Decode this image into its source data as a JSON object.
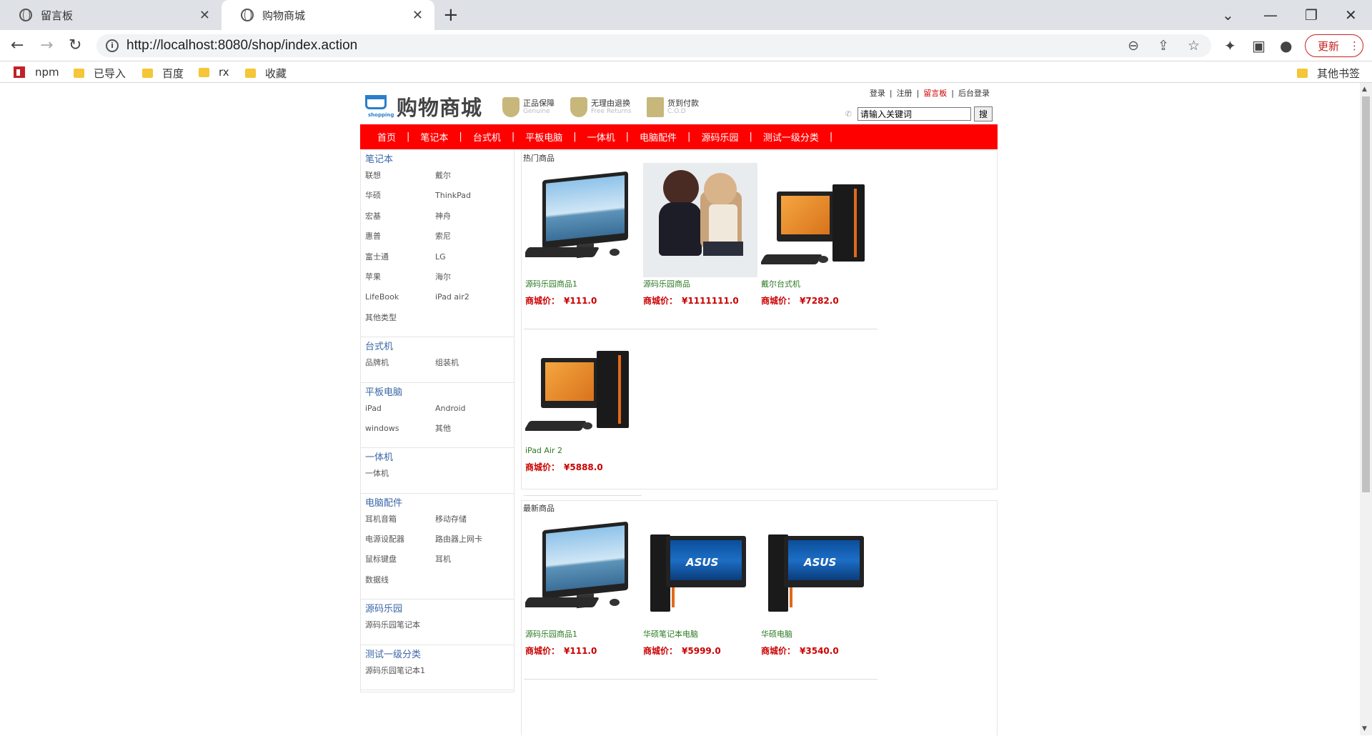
{
  "browser": {
    "tabs": [
      {
        "title": "留言板"
      },
      {
        "title": "购物商城"
      }
    ],
    "url": "http://localhost:8080/shop/index.action",
    "update_label": "更新",
    "bookmarks": [
      "npm",
      "已导入",
      "百度",
      "rx",
      "收藏"
    ],
    "other_bookmarks": "其他书签"
  },
  "site": {
    "logo_text": "购物商城",
    "logo_sub": "shopping",
    "badges": [
      {
        "title": "正品保障",
        "sub": "Genuine"
      },
      {
        "title": "无理由退换",
        "sub": "Free Returns"
      },
      {
        "title": "货到付款",
        "sub": "C.O.D"
      }
    ],
    "toplinks": {
      "login": "登录",
      "register": "注册",
      "guestbook": "留言板",
      "admin": "后台登录",
      "sep": "|"
    },
    "search": {
      "value": "请输入关键词",
      "button": "搜"
    },
    "nav": [
      "首页",
      "笔记本",
      "台式机",
      "平板电脑",
      "一体机",
      "电脑配件",
      "源码乐园",
      "测试一级分类"
    ],
    "nav_sep": "|",
    "categories": [
      {
        "name": "笔记本",
        "subs": [
          "联想",
          "戴尔",
          "华硕",
          "ThinkPad",
          "宏基",
          "神舟",
          "惠普",
          "索尼",
          "富士通",
          "LG",
          "苹果",
          "海尔",
          "LifeBook",
          "iPad air2",
          "其他类型"
        ]
      },
      {
        "name": "台式机",
        "subs": [
          "品牌机",
          "组装机"
        ]
      },
      {
        "name": "平板电脑",
        "subs": [
          "iPad",
          "Android",
          "windows",
          "其他"
        ]
      },
      {
        "name": "一体机",
        "subs": [
          "一体机"
        ]
      },
      {
        "name": "电脑配件",
        "subs": [
          "耳机音箱",
          "移动存储",
          "电源设配器",
          "路由器上网卡",
          "鼠标键盘",
          "耳机",
          "数据线"
        ]
      },
      {
        "name": "源码乐园",
        "subs": [
          "源码乐园笔记本"
        ]
      },
      {
        "name": "测试一级分类",
        "subs": [
          "源码乐园笔记本1"
        ]
      }
    ],
    "price_label": "商城价：",
    "hot": {
      "title": "热门商品",
      "products": [
        {
          "name": "源码乐园商品1",
          "price": "¥111.0",
          "image": "all-in-one"
        },
        {
          "name": "源码乐园商品",
          "price": "¥1111111.0",
          "image": "anime"
        },
        {
          "name": "戴尔台式机",
          "price": "¥7282.0",
          "image": "desktop"
        },
        {
          "name": "iPad Air 2",
          "price": "¥5888.0",
          "image": "desktop"
        }
      ]
    },
    "latest": {
      "title": "最新商品",
      "products": [
        {
          "name": "源码乐园商品1",
          "price": "¥111.0",
          "image": "all-in-one"
        },
        {
          "name": "华硕笔记本电脑",
          "price": "¥5999.0",
          "image": "asus"
        },
        {
          "name": "华硕电脑",
          "price": "¥3540.0",
          "image": "asus"
        }
      ]
    }
  },
  "colors": {
    "nav_bg": "#ff0000",
    "category": "#3a66a7",
    "product_name": "#2b7a22",
    "price": "#cc0000"
  }
}
